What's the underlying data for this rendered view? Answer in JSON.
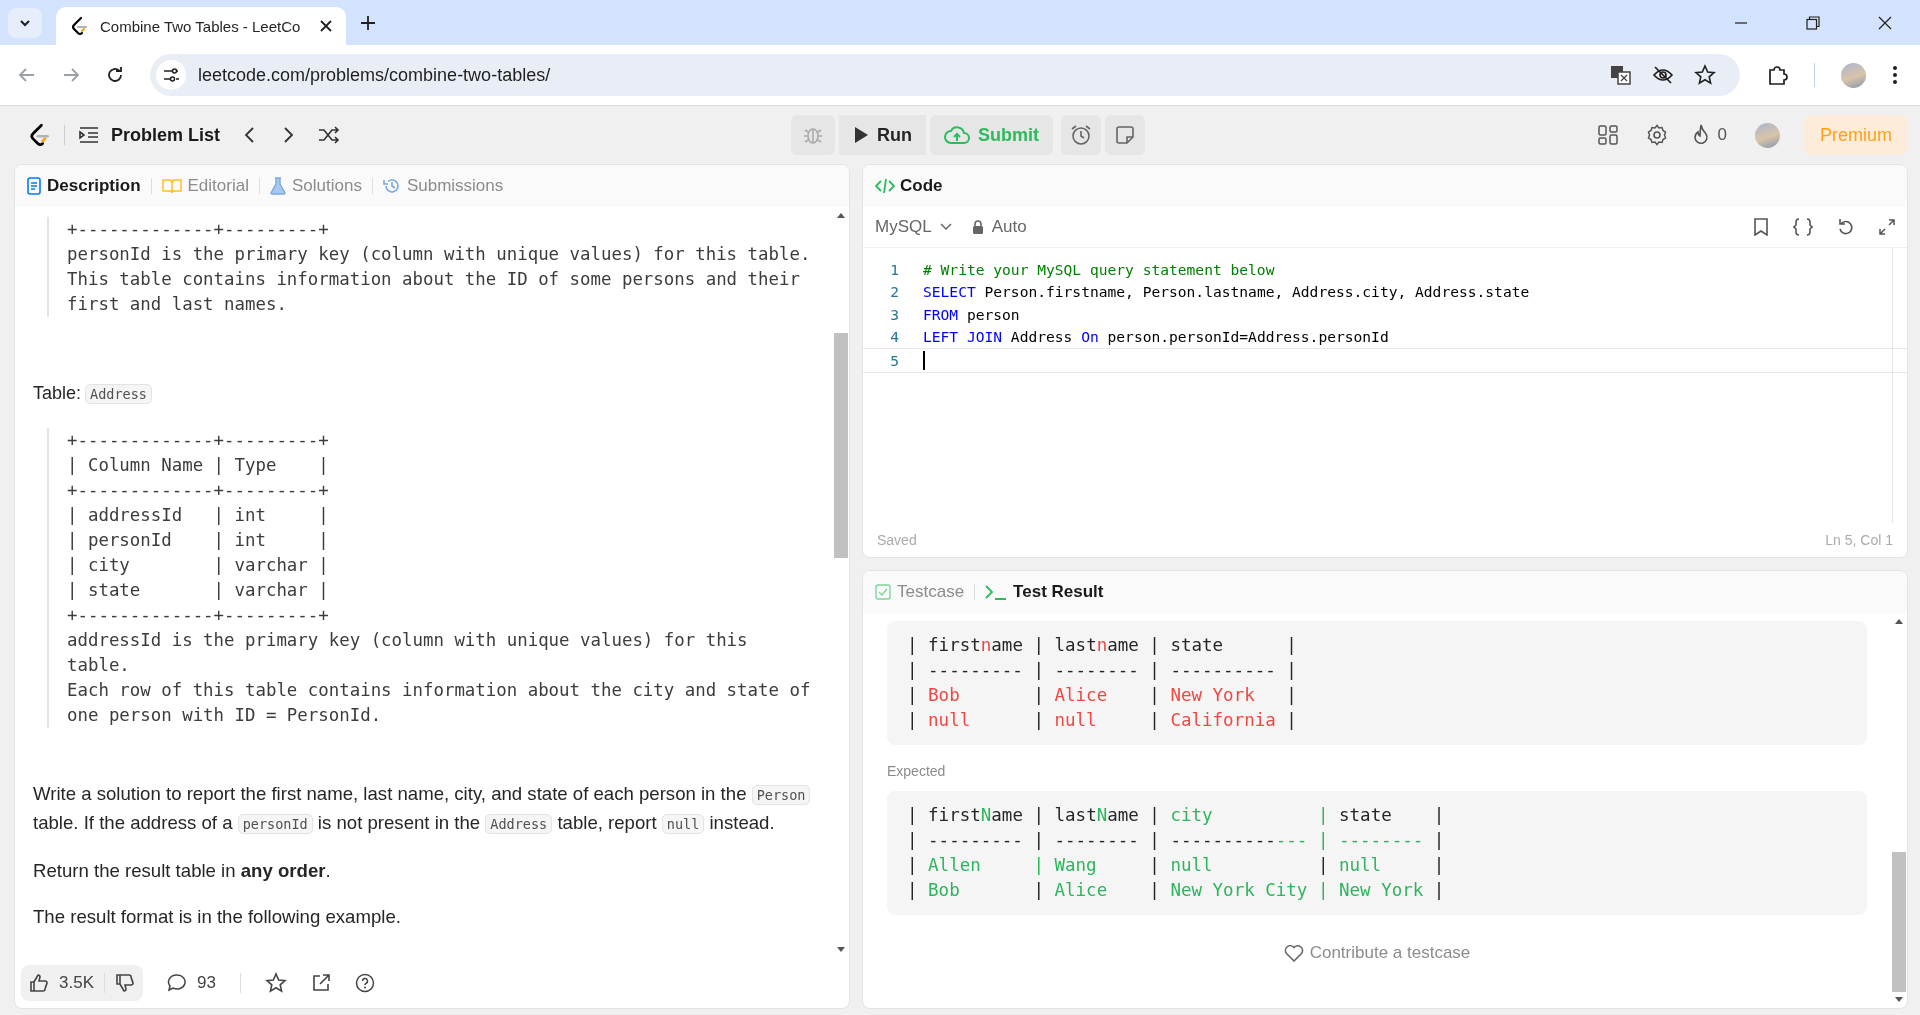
{
  "browser": {
    "tab_title": "Combine Two Tables - LeetCo",
    "url": "leetcode.com/problems/combine-two-tables/"
  },
  "header": {
    "problem_list": "Problem List",
    "run": "Run",
    "submit": "Submit",
    "streak": "0",
    "premium": "Premium"
  },
  "description_panel": {
    "tabs": [
      {
        "label": "Description",
        "selected": true
      },
      {
        "label": "Editorial",
        "selected": false
      },
      {
        "label": "Solutions",
        "selected": false
      },
      {
        "label": "Submissions",
        "selected": false
      }
    ],
    "content": [
      {
        "kind": "pre",
        "lines": [
          "+-------------+---------+",
          "personId is the primary key (column with unique values) for this table.",
          "This table contains information about the ID of some persons and their",
          "first and last names."
        ]
      },
      {
        "kind": "table_label",
        "label": "Table:",
        "code": "Address"
      },
      {
        "kind": "pre",
        "lines": [
          "+-------------+---------+",
          "| Column Name | Type    |",
          "+-------------+---------+",
          "| addressId   | int     |",
          "| personId    | int     |",
          "| city        | varchar |",
          "| state       | varchar |",
          "+-------------+---------+",
          "addressId is the primary key (column with unique values) for this",
          "table.",
          "Each row of this table contains information about the city and state of",
          "one person with ID = PersonId."
        ]
      },
      {
        "kind": "paragraph",
        "parts": [
          {
            "text": "Write a solution to report the first name, last name, city, and state of each person in the ",
            "code": false
          },
          {
            "text": "Person",
            "code": true
          },
          {
            "text": " table. If the address of a ",
            "code": false
          },
          {
            "text": "personId",
            "code": true
          },
          {
            "text": " is not present in the ",
            "code": false
          },
          {
            "text": "Address",
            "code": true
          },
          {
            "text": " table, report ",
            "code": false
          },
          {
            "text": "null",
            "code": true
          },
          {
            "text": " instead.",
            "code": false
          }
        ]
      },
      {
        "kind": "paragraph",
        "parts": [
          {
            "text": "Return the result table in **any order**.",
            "code": false
          }
        ]
      },
      {
        "kind": "paragraph",
        "parts": [
          {
            "text": "The result format is in the following example.",
            "code": false
          }
        ]
      }
    ],
    "footer": {
      "likes": "3.5K",
      "comments": "93"
    }
  },
  "code_panel": {
    "title": "Code",
    "language": "MySQL",
    "mode": "Auto",
    "status": "Saved",
    "cursor_position": "Ln 5, Col 1",
    "lines": [
      {
        "number": "1",
        "active": false,
        "tokens": [
          {
            "text": "# Write your MySQL query statement below",
            "kind": "comment"
          }
        ]
      },
      {
        "number": "2",
        "active": false,
        "tokens": [
          {
            "text": "SELECT",
            "kind": "keyword"
          },
          {
            "text": " Person.firstname, Person.lastname, Address.city, Address.state",
            "kind": "plain"
          }
        ]
      },
      {
        "number": "3",
        "active": false,
        "tokens": [
          {
            "text": "FROM",
            "kind": "keyword"
          },
          {
            "text": " person",
            "kind": "plain"
          }
        ]
      },
      {
        "number": "4",
        "active": false,
        "tokens": [
          {
            "text": "LEFT JOIN",
            "kind": "keyword"
          },
          {
            "text": " Address ",
            "kind": "plain"
          },
          {
            "text": "On",
            "kind": "keyword"
          },
          {
            "text": " person.personId=Address.personId",
            "kind": "plain"
          }
        ]
      },
      {
        "number": "5",
        "active": true
      }
    ]
  },
  "result_panel": {
    "tabs": [
      {
        "label": "Testcase",
        "selected": false
      },
      {
        "label": "Test Result",
        "selected": true
      }
    ],
    "output_lines": [
      [
        {
          "text": "| first",
          "kind": "same"
        },
        {
          "text": "n",
          "kind": "removed"
        },
        {
          "text": "ame | last",
          "kind": "same"
        },
        {
          "text": "n",
          "kind": "removed"
        },
        {
          "text": "ame | state      |",
          "kind": "same"
        }
      ],
      [
        {
          "text": "| --------- | -------- | ---------- |",
          "kind": "same"
        }
      ],
      [
        {
          "text": "| ",
          "kind": "same"
        },
        {
          "text": "Bob      ",
          "kind": "removed"
        },
        {
          "text": " | ",
          "kind": "same"
        },
        {
          "text": "Alice   ",
          "kind": "removed"
        },
        {
          "text": " | ",
          "kind": "same"
        },
        {
          "text": "New York  ",
          "kind": "removed"
        },
        {
          "text": " |",
          "kind": "same"
        }
      ],
      [
        {
          "text": "| ",
          "kind": "same"
        },
        {
          "text": "null     ",
          "kind": "removed"
        },
        {
          "text": " | ",
          "kind": "same"
        },
        {
          "text": "null    ",
          "kind": "removed"
        },
        {
          "text": " | ",
          "kind": "same"
        },
        {
          "text": "California",
          "kind": "removed"
        },
        {
          "text": " |",
          "kind": "same"
        }
      ]
    ],
    "expected_label": "Expected",
    "expected_lines": [
      [
        {
          "text": "| first",
          "kind": "same"
        },
        {
          "text": "N",
          "kind": "added"
        },
        {
          "text": "ame | last",
          "kind": "same"
        },
        {
          "text": "N",
          "kind": "added"
        },
        {
          "text": "ame | ",
          "kind": "same"
        },
        {
          "text": "city          |",
          "kind": "added"
        },
        {
          "text": " state    |",
          "kind": "same"
        }
      ],
      [
        {
          "text": "| --------- | -------- | ----------",
          "kind": "same"
        },
        {
          "text": "--- | --------",
          "kind": "added"
        },
        {
          "text": " |",
          "kind": "same"
        }
      ],
      [
        {
          "text": "| ",
          "kind": "same"
        },
        {
          "text": "Allen     | Wang    ",
          "kind": "added"
        },
        {
          "text": " | ",
          "kind": "same"
        },
        {
          "text": "null         ",
          "kind": "added"
        },
        {
          "text": " | ",
          "kind": "same"
        },
        {
          "text": "null    ",
          "kind": "added"
        },
        {
          "text": " |",
          "kind": "same"
        }
      ],
      [
        {
          "text": "| ",
          "kind": "same"
        },
        {
          "text": "Bob      ",
          "kind": "added"
        },
        {
          "text": " | ",
          "kind": "same"
        },
        {
          "text": "Alice   ",
          "kind": "added"
        },
        {
          "text": " | ",
          "kind": "same"
        },
        {
          "text": "New York City | New York",
          "kind": "added"
        },
        {
          "text": " |",
          "kind": "same"
        }
      ]
    ],
    "contribute": "Contribute a testcase"
  }
}
